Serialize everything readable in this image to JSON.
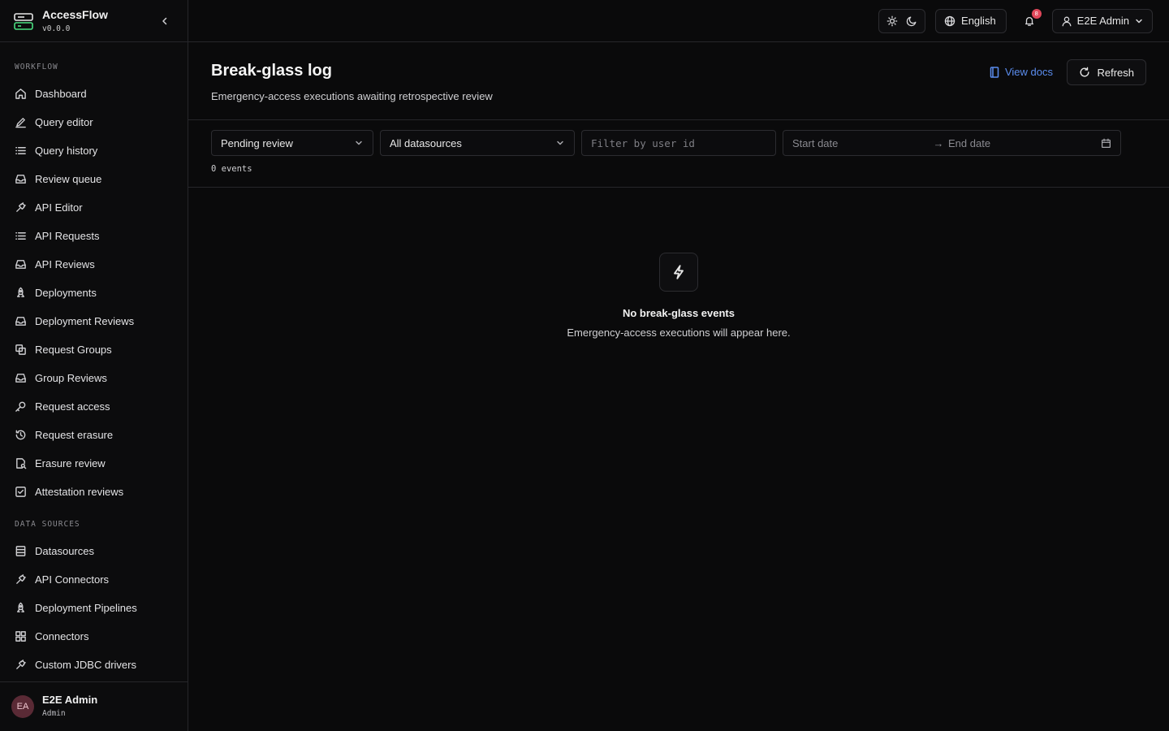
{
  "brand": {
    "name": "AccessFlow",
    "version": "v0.0.0"
  },
  "sidebar": {
    "sections": [
      {
        "label": "WORKFLOW",
        "items": [
          {
            "label": "Dashboard",
            "icon": "home-icon"
          },
          {
            "label": "Query editor",
            "icon": "pen-icon"
          },
          {
            "label": "Query history",
            "icon": "list-icon"
          },
          {
            "label": "Review queue",
            "icon": "inbox-icon"
          },
          {
            "label": "API Editor",
            "icon": "plug-icon"
          },
          {
            "label": "API Requests",
            "icon": "list-icon"
          },
          {
            "label": "API Reviews",
            "icon": "inbox-icon"
          },
          {
            "label": "Deployments",
            "icon": "rocket-icon"
          },
          {
            "label": "Deployment Reviews",
            "icon": "inbox-icon"
          },
          {
            "label": "Request Groups",
            "icon": "layers-icon"
          },
          {
            "label": "Group Reviews",
            "icon": "inbox-icon"
          },
          {
            "label": "Request access",
            "icon": "key-icon"
          },
          {
            "label": "Request erasure",
            "icon": "history-icon"
          },
          {
            "label": "Erasure review",
            "icon": "file-search-icon"
          },
          {
            "label": "Attestation reviews",
            "icon": "check-square-icon"
          }
        ]
      },
      {
        "label": "DATA SOURCES",
        "items": [
          {
            "label": "Datasources",
            "icon": "database-icon"
          },
          {
            "label": "API Connectors",
            "icon": "plug-icon"
          },
          {
            "label": "Deployment Pipelines",
            "icon": "rocket-icon"
          },
          {
            "label": "Connectors",
            "icon": "grid-icon"
          },
          {
            "label": "Custom JDBC drivers",
            "icon": "plug-icon"
          }
        ]
      }
    ]
  },
  "user": {
    "initials": "EA",
    "name": "E2E Admin",
    "role": "Admin"
  },
  "topbar": {
    "language": "English",
    "notification_count": "8",
    "user_label": "E2E Admin"
  },
  "page": {
    "title": "Break-glass log",
    "subtitle": "Emergency-access executions awaiting retrospective review",
    "docs_label": "View docs",
    "refresh_label": "Refresh"
  },
  "filters": {
    "status_value": "Pending review",
    "datasource_value": "All datasources",
    "user_placeholder": "Filter by user id",
    "start_placeholder": "Start date",
    "end_placeholder": "End date",
    "count_text": "0 events"
  },
  "empty": {
    "title": "No break-glass events",
    "description": "Emergency-access executions will appear here."
  },
  "colors": {
    "accent": "#5b8def",
    "badge": "#e0475a",
    "logo": "#4ade80"
  }
}
